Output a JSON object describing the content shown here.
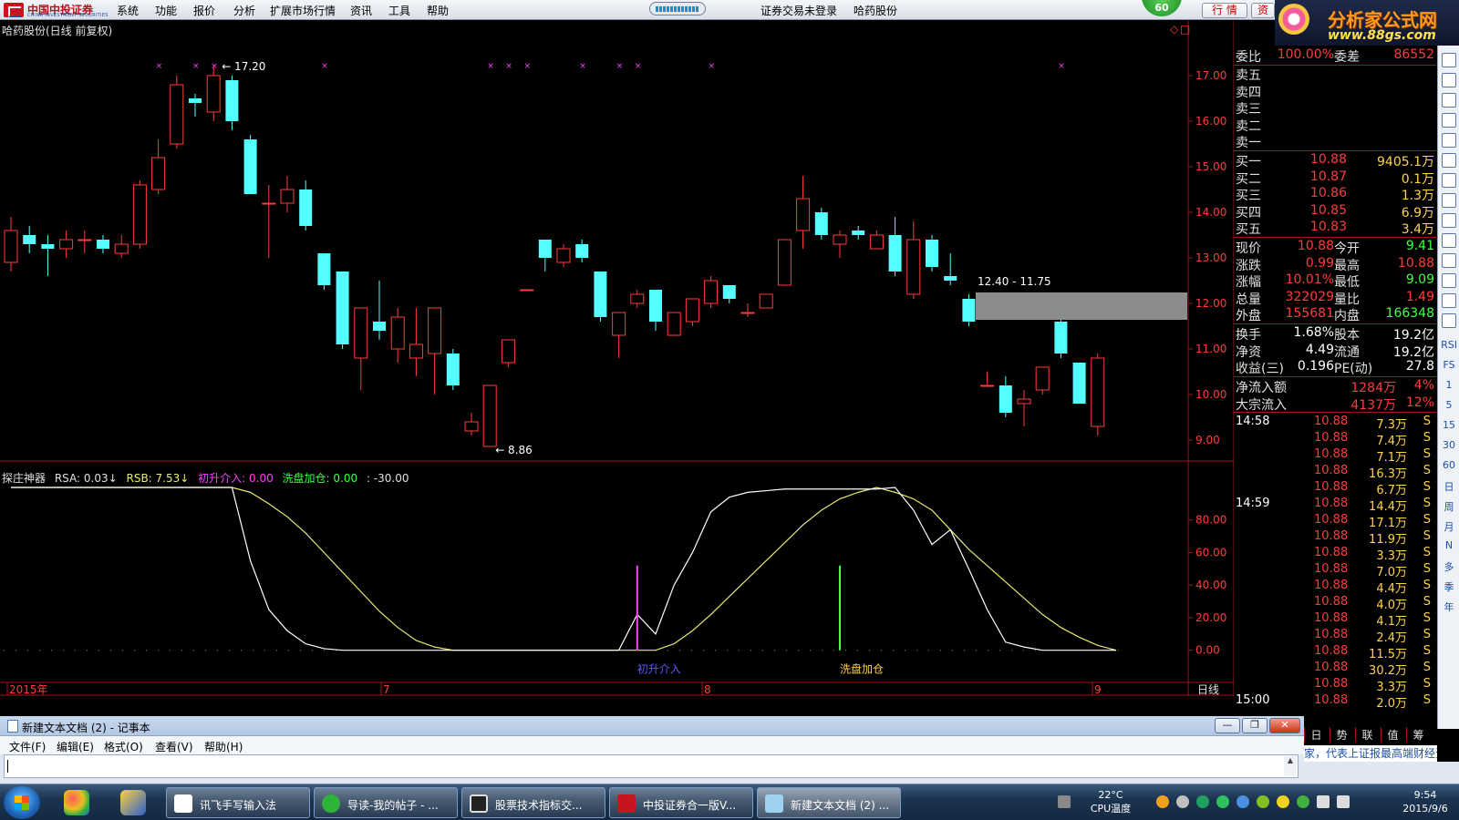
{
  "app": {
    "logo_cn": "中国中投证券",
    "logo_en": "CHINA INVESTMENT SECURITIES",
    "menu": [
      "系统",
      "功能",
      "报价",
      "分析",
      "扩展市场行情",
      "资讯",
      "工具",
      "帮助"
    ],
    "login_status": "证券交易未登录",
    "stock_name": "哈药股份",
    "badge": "60",
    "btn_quote": "行 情",
    "btn_info": "资",
    "site_name": "分析家公式网",
    "site_url": "www.88gs.com"
  },
  "chart": {
    "title": "哈药股份(日线 前复权)",
    "high_label": "17.20",
    "low_label": "8.86",
    "range_label": "12.40 - 11.75",
    "y_ticks": [
      "17.00",
      "16.00",
      "15.00",
      "14.00",
      "13.00",
      "12.00",
      "11.00",
      "10.00",
      "9.00"
    ],
    "period": "日线",
    "time_labels": [
      "2015年",
      "7",
      "8",
      "9"
    ],
    "colors": {
      "up": "#ff3c3c",
      "down": "#54ffff",
      "grid": "#a3151b",
      "k_line": "#ffffff",
      "d_line": "#e8e870"
    }
  },
  "chart_data": {
    "type": "candlestick",
    "ylim": [
      8.6,
      17.8
    ],
    "candles": [
      [
        12.9,
        13.6,
        13.9,
        12.7
      ],
      [
        13.5,
        13.3,
        13.7,
        13.1
      ],
      [
        13.3,
        13.2,
        13.5,
        12.6
      ],
      [
        13.2,
        13.4,
        13.6,
        13.0
      ],
      [
        13.4,
        13.4,
        13.6,
        13.1
      ],
      [
        13.4,
        13.2,
        13.5,
        13.1
      ],
      [
        13.1,
        13.3,
        13.5,
        13.0
      ],
      [
        13.3,
        14.6,
        14.7,
        13.2
      ],
      [
        14.5,
        15.2,
        15.6,
        14.4
      ],
      [
        15.5,
        16.8,
        17.0,
        15.4
      ],
      [
        16.5,
        16.4,
        16.6,
        16.1
      ],
      [
        16.2,
        17.0,
        17.2,
        16.0
      ],
      [
        16.9,
        16.0,
        17.0,
        15.8
      ],
      [
        15.6,
        14.4,
        15.7,
        14.4
      ],
      [
        14.2,
        14.2,
        14.6,
        13.0
      ],
      [
        14.2,
        14.5,
        14.8,
        14.0
      ],
      [
        14.5,
        13.7,
        14.7,
        13.6
      ],
      [
        13.1,
        12.4,
        13.1,
        12.3
      ],
      [
        12.7,
        11.1,
        12.7,
        11.0
      ],
      [
        10.8,
        11.9,
        11.9,
        10.1
      ],
      [
        11.6,
        11.4,
        12.5,
        11.2
      ],
      [
        11.0,
        11.7,
        11.9,
        10.7
      ],
      [
        10.8,
        11.1,
        11.9,
        10.4
      ],
      [
        10.9,
        11.9,
        11.9,
        10.0
      ],
      [
        10.9,
        10.2,
        11.0,
        10.1
      ],
      [
        9.2,
        9.4,
        9.6,
        9.1
      ],
      [
        8.86,
        10.2,
        10.2,
        8.86
      ],
      [
        10.7,
        11.2,
        11.2,
        10.6
      ],
      [
        12.3,
        12.3,
        12.3,
        12.3
      ],
      [
        13.4,
        13.0,
        13.4,
        12.7
      ],
      [
        12.9,
        13.2,
        13.3,
        12.8
      ],
      [
        13.3,
        13.0,
        13.4,
        12.9
      ],
      [
        12.7,
        11.7,
        12.7,
        11.6
      ],
      [
        11.3,
        11.8,
        11.8,
        10.8
      ],
      [
        12.0,
        12.2,
        12.3,
        11.9
      ],
      [
        12.3,
        11.6,
        12.3,
        11.4
      ],
      [
        11.3,
        11.8,
        11.8,
        11.3
      ],
      [
        11.6,
        12.1,
        12.1,
        11.5
      ],
      [
        12.0,
        12.5,
        12.6,
        11.9
      ],
      [
        12.4,
        12.1,
        12.4,
        12.0
      ],
      [
        11.8,
        11.8,
        12.0,
        11.7
      ],
      [
        11.9,
        12.2,
        12.2,
        11.9
      ],
      [
        12.4,
        13.4,
        13.4,
        12.4
      ],
      [
        13.6,
        14.3,
        14.8,
        13.2
      ],
      [
        14.0,
        13.5,
        14.1,
        13.4
      ],
      [
        13.3,
        13.5,
        13.6,
        13.0
      ],
      [
        13.6,
        13.5,
        13.7,
        13.4
      ],
      [
        13.2,
        13.5,
        13.6,
        13.2
      ],
      [
        13.5,
        12.7,
        13.9,
        12.6
      ],
      [
        12.2,
        13.4,
        13.8,
        12.1
      ],
      [
        13.4,
        12.8,
        13.5,
        12.7
      ],
      [
        12.6,
        12.5,
        13.1,
        12.4
      ],
      [
        12.1,
        11.6,
        12.2,
        11.5
      ],
      [
        10.2,
        10.2,
        10.5,
        10.2
      ],
      [
        10.2,
        9.6,
        10.4,
        9.5
      ],
      [
        9.8,
        9.9,
        10.1,
        9.3
      ],
      [
        10.1,
        10.6,
        10.6,
        10.0
      ],
      [
        11.6,
        10.9,
        11.7,
        10.8
      ],
      [
        10.7,
        9.8,
        10.7,
        9.8
      ],
      [
        9.3,
        10.8,
        10.9,
        9.1
      ]
    ],
    "ind_ylim": [
      -8,
      100
    ],
    "ind_ticks": [
      "80.00",
      "60.00",
      "40.00",
      "20.00",
      "0.00"
    ],
    "k_series": [
      100,
      100,
      100,
      100,
      100,
      100,
      100,
      100,
      100,
      100,
      100,
      100,
      100,
      55,
      25,
      12,
      4,
      1,
      0,
      0,
      0,
      0,
      0,
      0,
      0,
      0,
      0,
      0,
      0,
      0,
      0,
      0,
      0,
      0,
      22,
      10,
      40,
      60,
      85,
      94,
      97,
      98,
      99,
      99,
      99,
      99,
      99,
      99,
      100,
      86,
      65,
      74,
      50,
      25,
      5,
      2,
      0,
      0,
      0,
      0,
      0
    ],
    "d_series": [
      100,
      100,
      100,
      100,
      100,
      100,
      100,
      100,
      100,
      100,
      100,
      100,
      100,
      97,
      90,
      82,
      72,
      60,
      48,
      36,
      24,
      14,
      6,
      2,
      0,
      0,
      0,
      0,
      0,
      0,
      0,
      0,
      0,
      0,
      0,
      0,
      4,
      12,
      22,
      33,
      44,
      55,
      66,
      77,
      86,
      93,
      97,
      100,
      97,
      93,
      86,
      74,
      62,
      52,
      42,
      32,
      22,
      14,
      8,
      3,
      0
    ],
    "signals": [
      {
        "index": 34,
        "color": "#ff40ff"
      },
      {
        "index": 45,
        "color": "#40ff40"
      }
    ],
    "cross_marks": [
      8,
      10,
      11,
      17,
      26,
      27,
      28,
      31,
      33,
      34,
      38,
      57
    ]
  },
  "indicator": {
    "name": "探庄神器",
    "rsa": "RSA: 0.03↓",
    "rsb": "RSB: 7.53↓",
    "chushi": "初升介入: 0.00",
    "xipan": "洗盘加仓: 0.00",
    "extra": ": -30.00",
    "label_chushi": "初升介入",
    "label_xipan": "洗盘加仓"
  },
  "quote": {
    "weibi_label": "委比",
    "weibi_val": "100.00%",
    "weicha_label": "委差",
    "weicha_val": "86552",
    "sell": [
      "卖五",
      "卖四",
      "卖三",
      "卖二",
      "卖一"
    ],
    "buy": [
      {
        "k": "买一",
        "p": "10.88",
        "v": "9405.1万"
      },
      {
        "k": "买二",
        "p": "10.87",
        "v": "0.1万"
      },
      {
        "k": "买三",
        "p": "10.86",
        "v": "1.3万"
      },
      {
        "k": "买四",
        "p": "10.85",
        "v": "6.9万"
      },
      {
        "k": "买五",
        "p": "10.83",
        "v": "3.4万"
      }
    ],
    "stats": [
      {
        "k1": "现价",
        "v1": "10.88",
        "k2": "今开",
        "v2": "9.41",
        "c2": "#40ff40"
      },
      {
        "k1": "涨跌",
        "v1": "0.99",
        "k2": "最高",
        "v2": "10.88",
        "c2": "#ff3c3c"
      },
      {
        "k1": "涨幅",
        "v1": "10.01%",
        "k2": "最低",
        "v2": "9.09",
        "c2": "#40ff40"
      },
      {
        "k1": "总量",
        "v1": "322029",
        "k2": "量比",
        "v2": "1.49",
        "c2": "#ff3c3c"
      },
      {
        "k1": "外盘",
        "v1": "155681",
        "k2": "内盘",
        "v2": "166348",
        "c2": "#40ff40"
      }
    ],
    "stats2": [
      {
        "k1": "换手",
        "v1": "1.68%",
        "k2": "股本",
        "v2": "19.2亿"
      },
      {
        "k1": "净资",
        "v1": "4.49",
        "k2": "流通",
        "v2": "19.2亿"
      },
      {
        "k1": "收益(三)",
        "v1": "0.196",
        "k2": "PE(动)",
        "v2": "27.8"
      }
    ],
    "flow": [
      {
        "k": "净流入额",
        "v": "1284万",
        "p": "4%"
      },
      {
        "k": "大宗流入",
        "v": "4137万",
        "p": "12%"
      }
    ],
    "ticks": [
      {
        "t": "14:58",
        "p": "10.88",
        "v": "7.3万",
        "f": "S"
      },
      {
        "t": "",
        "p": "10.88",
        "v": "7.4万",
        "f": "S"
      },
      {
        "t": "",
        "p": "10.88",
        "v": "7.1万",
        "f": "S"
      },
      {
        "t": "",
        "p": "10.88",
        "v": "16.3万",
        "f": "S"
      },
      {
        "t": "",
        "p": "10.88",
        "v": "6.7万",
        "f": "S"
      },
      {
        "t": "14:59",
        "p": "10.88",
        "v": "14.4万",
        "f": "S"
      },
      {
        "t": "",
        "p": "10.88",
        "v": "17.1万",
        "f": "S"
      },
      {
        "t": "",
        "p": "10.88",
        "v": "11.9万",
        "f": "S"
      },
      {
        "t": "",
        "p": "10.88",
        "v": "3.3万",
        "f": "S"
      },
      {
        "t": "",
        "p": "10.88",
        "v": "7.0万",
        "f": "S"
      },
      {
        "t": "",
        "p": "10.88",
        "v": "4.4万",
        "f": "S"
      },
      {
        "t": "",
        "p": "10.88",
        "v": "4.0万",
        "f": "S"
      },
      {
        "t": "",
        "p": "10.88",
        "v": "4.1万",
        "f": "S"
      },
      {
        "t": "",
        "p": "10.88",
        "v": "2.4万",
        "f": "S"
      },
      {
        "t": "",
        "p": "10.88",
        "v": "11.5万",
        "f": "S"
      },
      {
        "t": "",
        "p": "10.88",
        "v": "30.2万",
        "f": "S"
      },
      {
        "t": "",
        "p": "10.88",
        "v": "3.3万",
        "f": "S"
      },
      {
        "t": "15:00",
        "p": "10.88",
        "v": "2.0万",
        "f": "S"
      }
    ],
    "tabs": [
      "日",
      "势",
      "联",
      "值",
      "筹"
    ],
    "ticker_text": "家，代表上证报最高端财经资讯"
  },
  "side_toolbar": [
    "RSI",
    "FS",
    "1",
    "5",
    "15",
    "30",
    "60",
    "日",
    "周",
    "月",
    "N",
    "多",
    "季",
    "年"
  ],
  "notepad": {
    "title": "新建文本文档 (2) - 记事本",
    "menu": [
      "文件(F)",
      "编辑(E)",
      "格式(O)",
      "查看(V)",
      "帮助(H)"
    ]
  },
  "taskbar": {
    "tasks": [
      "讯飞手写输入法",
      "导读-我的帖子 - ...",
      "股票技术指标交...",
      "中投证券合一版V...",
      "新建文本文档 (2) ..."
    ],
    "temp": "22°C",
    "temp_label": "CPU温度",
    "time": "9:54",
    "date": "2015/9/6"
  }
}
